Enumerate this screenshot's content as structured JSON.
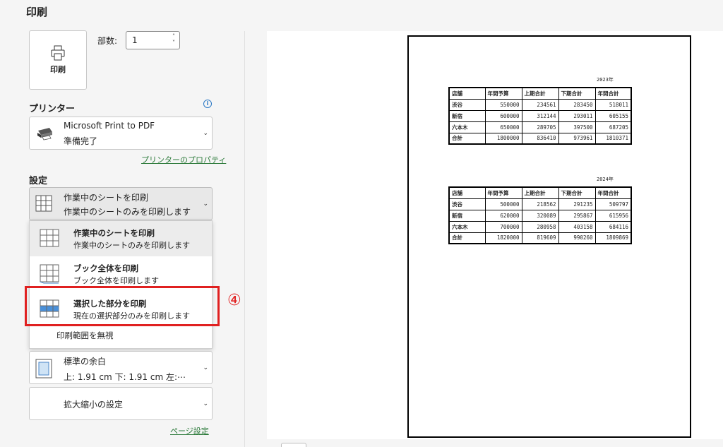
{
  "header": {
    "title": "印刷"
  },
  "print_button": {
    "label": "印刷"
  },
  "copies": {
    "label": "部数:",
    "value": "1"
  },
  "printer": {
    "section_title": "プリンター",
    "name": "Microsoft Print to PDF",
    "status": "準備完了",
    "properties_link": "プリンターのプロパティ"
  },
  "settings": {
    "section_title": "設定",
    "selected": {
      "title": "作業中のシートを印刷",
      "subtitle": "作業中のシートのみを印刷します"
    },
    "menu": [
      {
        "title": "作業中のシートを印刷",
        "subtitle": "作業中のシートのみを印刷します"
      },
      {
        "title": "ブック全体を印刷",
        "subtitle": "ブック全体を印刷します"
      },
      {
        "title": "選択した部分を印刷",
        "subtitle": "現在の選択部分のみを印刷します"
      }
    ],
    "ignore_area": "印刷範囲を無視",
    "margins": {
      "title": "標準の余白",
      "subtitle": "上: 1.91 cm 下: 1.91 cm 左:⋯"
    },
    "scaling": {
      "title": "拡大縮小の設定"
    },
    "page_setup_link": "ページ設定"
  },
  "annotation": {
    "step": "④",
    "color": "#e02020"
  },
  "preview": {
    "tables": [
      {
        "year": "2023年",
        "headers": [
          "店舗",
          "年間予算",
          "上期合計",
          "下期合計",
          "年間合計"
        ],
        "rows": [
          [
            "渋谷",
            "550000",
            "234561",
            "283450",
            "518011"
          ],
          [
            "新宿",
            "600000",
            "312144",
            "293011",
            "605155"
          ],
          [
            "六本木",
            "650000",
            "289705",
            "397500",
            "687205"
          ],
          [
            "合計",
            "1800000",
            "836410",
            "973961",
            "1810371"
          ]
        ]
      },
      {
        "year": "2024年",
        "headers": [
          "店舗",
          "年間予算",
          "上期合計",
          "下期合計",
          "年間合計"
        ],
        "rows": [
          [
            "渋谷",
            "500000",
            "218562",
            "291235",
            "509797"
          ],
          [
            "新宿",
            "620000",
            "320089",
            "295867",
            "615956"
          ],
          [
            "六本木",
            "700000",
            "280958",
            "403158",
            "684116"
          ],
          [
            "合計",
            "1820000",
            "819609",
            "990260",
            "1809869"
          ]
        ]
      }
    ]
  }
}
